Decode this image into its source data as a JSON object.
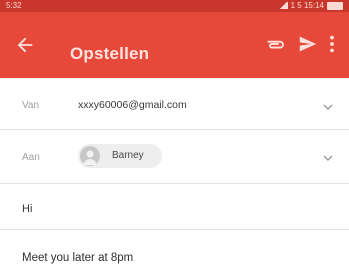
{
  "status_bar": {
    "left_text": "5:32",
    "right_text": "1 5 15:14"
  },
  "app_bar": {
    "title": "Opstellen",
    "color": "#e6483a",
    "icons": [
      "back-arrow-icon",
      "attachment-icon",
      "send-icon",
      "more-vert-icon"
    ]
  },
  "compose": {
    "from_label": "Van",
    "from_value": "xxxy60006@gmail.com",
    "to_label": "Aan",
    "to_chip": "Barney",
    "subject": "Hi",
    "body": "Meet you later at 8pm"
  }
}
